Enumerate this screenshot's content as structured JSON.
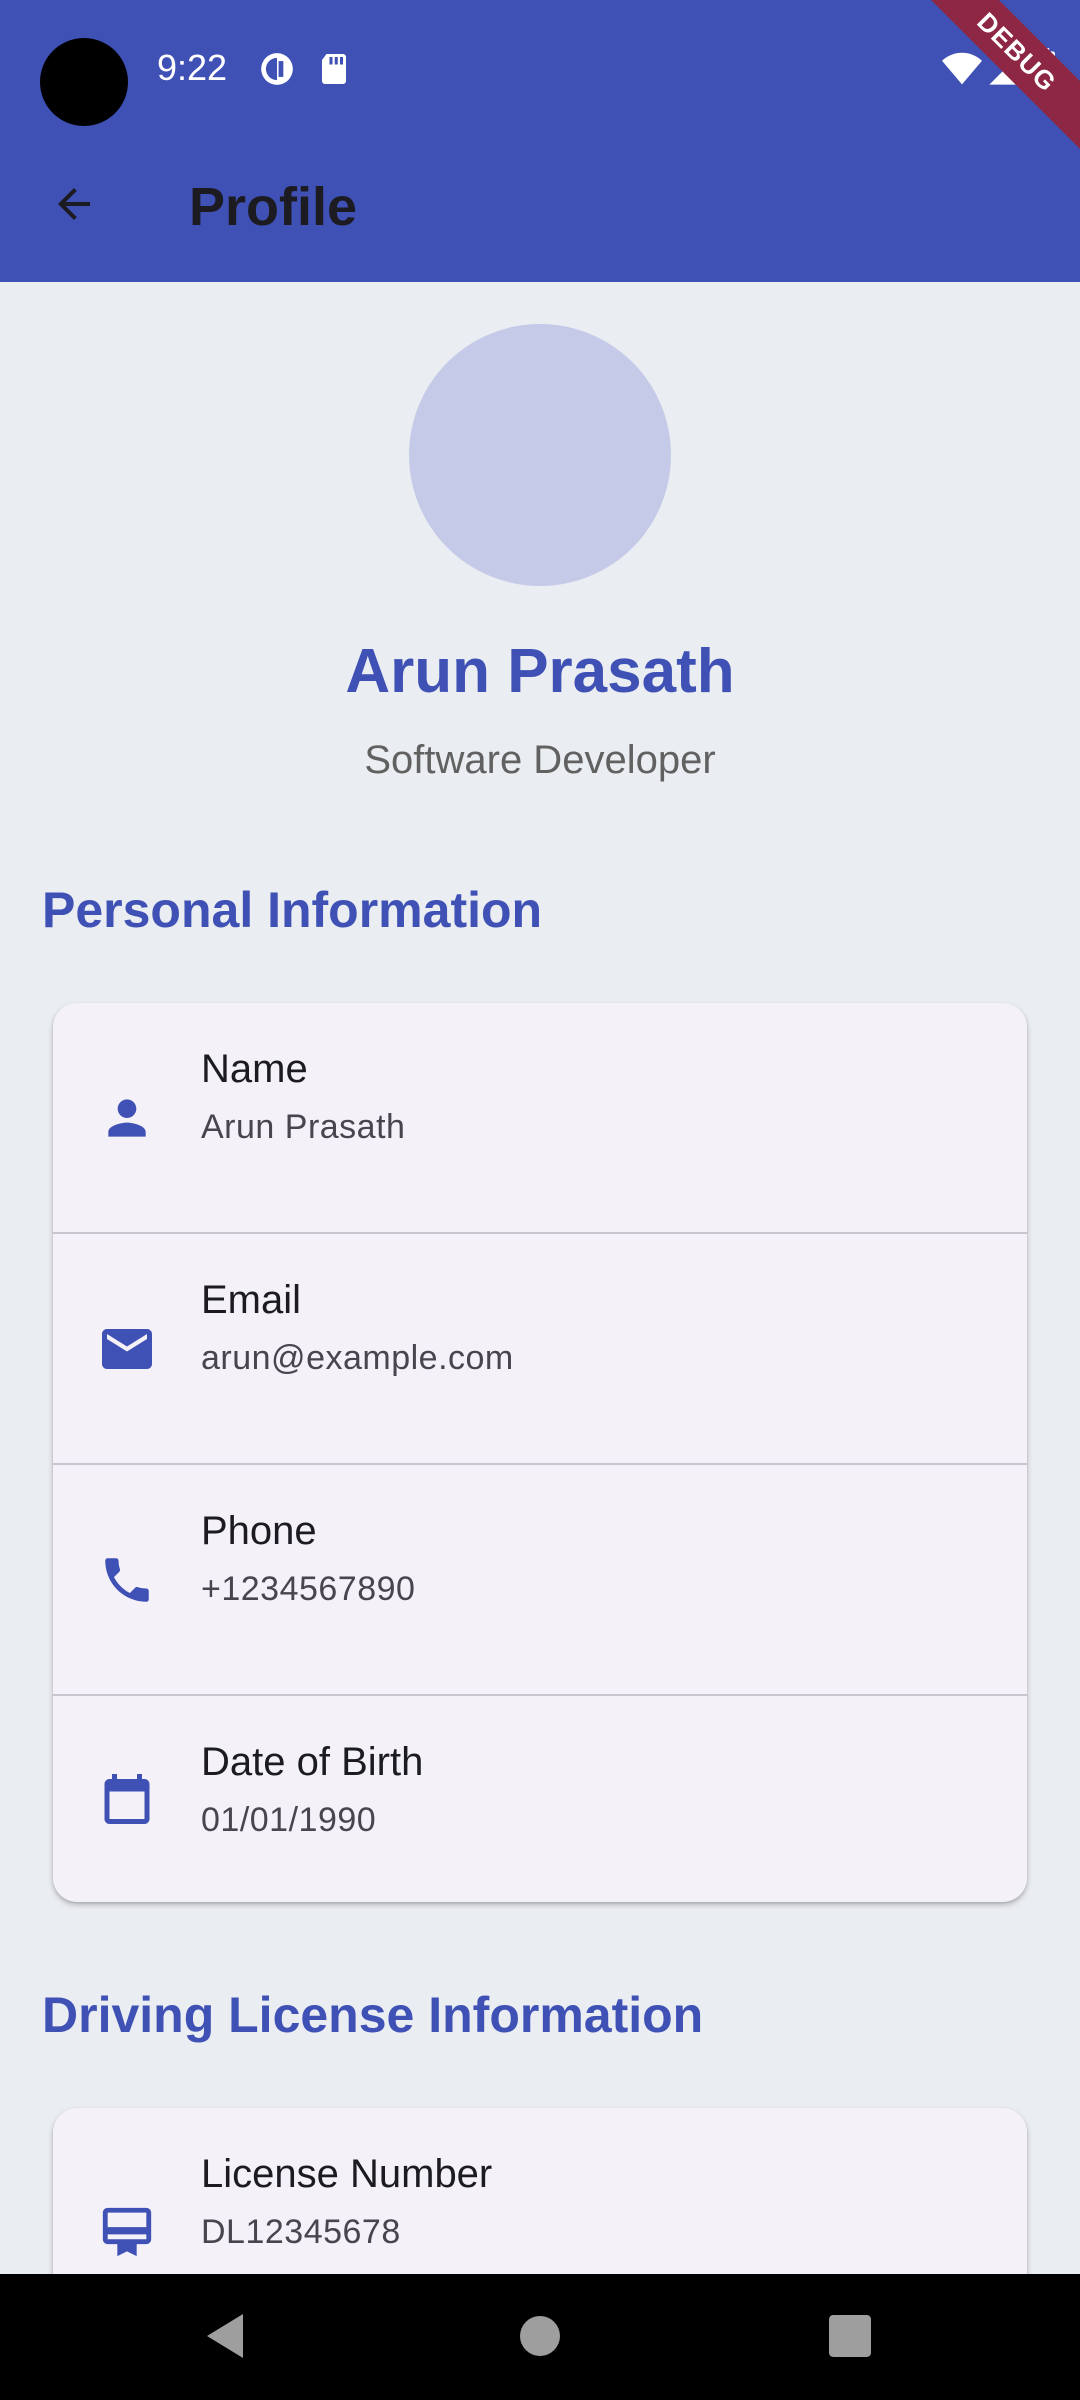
{
  "status_bar": {
    "time": "9:22",
    "debug_label": "DEBUG"
  },
  "app_bar": {
    "title": "Profile",
    "back_icon": "arrow-back-icon",
    "background_color": "#3f51b5"
  },
  "profile": {
    "name": "Arun Prasath",
    "role": "Software Developer",
    "avatar_color": "#c5cae9"
  },
  "sections": {
    "personal": {
      "title": "Personal Information",
      "rows": [
        {
          "icon": "person-icon",
          "label": "Name",
          "value": "Arun Prasath"
        },
        {
          "icon": "email-icon",
          "label": "Email",
          "value": "arun@example.com"
        },
        {
          "icon": "phone-icon",
          "label": "Phone",
          "value": "+1234567890"
        },
        {
          "icon": "calendar-icon",
          "label": "Date of Birth",
          "value": "01/01/1990"
        }
      ]
    },
    "license": {
      "title": "Driving License Information",
      "rows": [
        {
          "icon": "card-membership-icon",
          "label": "License Number",
          "value": "DL12345678"
        }
      ]
    }
  },
  "colors": {
    "accent": "#3f51b5",
    "page_background": "#eaedf1",
    "card_background": "#f4f1f8"
  }
}
